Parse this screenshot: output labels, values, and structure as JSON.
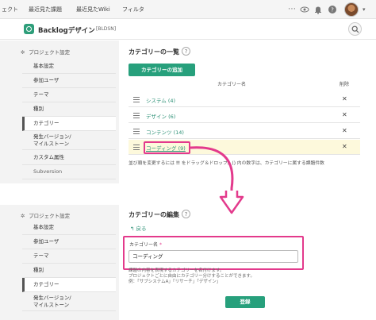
{
  "topnav": {
    "items": [
      "ェクト",
      "最近見た課題",
      "最近見たWiki",
      "フィルタ"
    ],
    "icons": [
      "more-icon",
      "eye-icon",
      "bell-icon",
      "help-icon"
    ],
    "avatar_caret": "▾"
  },
  "project": {
    "name": "Backlogデザイン",
    "key": "[BLDSN]"
  },
  "sidebar_top": {
    "header": "プロジェクト設定",
    "items": [
      "基本設定",
      "参加ユーザ",
      "テーマ",
      "種別",
      "カテゴリー",
      "発生バージョン/\nマイルストーン",
      "カスタム属性",
      "Subversion"
    ]
  },
  "categories_section": {
    "title": "カテゴリーの一覧",
    "add_button": "カテゴリーの追加",
    "col_name": "カテゴリー名",
    "col_delete": "削除",
    "rows": [
      {
        "name": "システム (4)"
      },
      {
        "name": "デザイン (6)"
      },
      {
        "name": "コンテンツ (14)"
      },
      {
        "name": "コーディング (9)"
      }
    ],
    "note": "並び順を変更するには ☰ をドラッグ＆ドロップ。() 内の数字は、カテゴリーに属する課題件数"
  },
  "sidebar_bottom": {
    "header": "プロジェクト設定",
    "items": [
      "基本設定",
      "参加ユーザ",
      "テーマ",
      "種別",
      "カテゴリー",
      "発生バージョン/\nマイルストーン"
    ]
  },
  "edit_section": {
    "title": "カテゴリーの編集",
    "back": "戻る",
    "label": "カテゴリー名",
    "required_mark": "*",
    "input_value": "コーディング",
    "hints": [
      "課題の内容を表現するカテゴリーを名付けます。",
      "プロジェクトごとに自由にカテゴリー分けすることができます。",
      "例：「サブシステムA」「リサーチ」「デザイン」"
    ],
    "submit": "登録"
  },
  "colors": {
    "accent": "#27a07c",
    "highlight": "#e33a8c"
  }
}
